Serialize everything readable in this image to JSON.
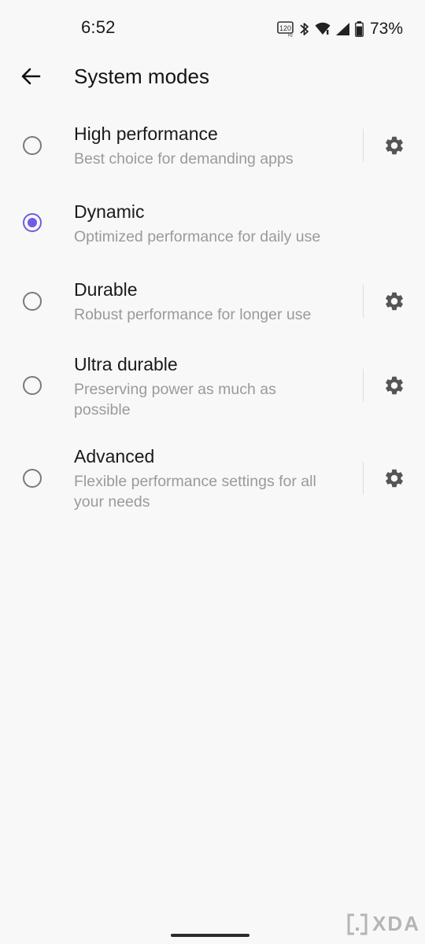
{
  "status_bar": {
    "time": "6:52",
    "refresh_rate": "120",
    "battery_percent": "73%",
    "icons": [
      "refresh-rate-icon",
      "bluetooth-icon",
      "wifi-icon",
      "cellular-signal-icon",
      "battery-icon"
    ]
  },
  "header": {
    "title": "System modes",
    "back_icon": "arrow-back-icon"
  },
  "modes": [
    {
      "title": "High performance",
      "description": "Best choice for demanding apps",
      "selected": false,
      "has_settings": true
    },
    {
      "title": "Dynamic",
      "description": "Optimized performance for daily use",
      "selected": true,
      "has_settings": false
    },
    {
      "title": "Durable",
      "description": "Robust performance for longer use",
      "selected": false,
      "has_settings": true
    },
    {
      "title": "Ultra durable",
      "description": "Preserving power as much as possible",
      "selected": false,
      "has_settings": true
    },
    {
      "title": "Advanced",
      "description": "Flexible performance settings for all your needs",
      "selected": false,
      "has_settings": true
    }
  ],
  "watermark": {
    "text": "XDA"
  },
  "colors": {
    "accent": "#6c5ce7",
    "background": "#f8f8f8",
    "primary_text": "#1a1a1a",
    "secondary_text": "#9a9a9a"
  }
}
